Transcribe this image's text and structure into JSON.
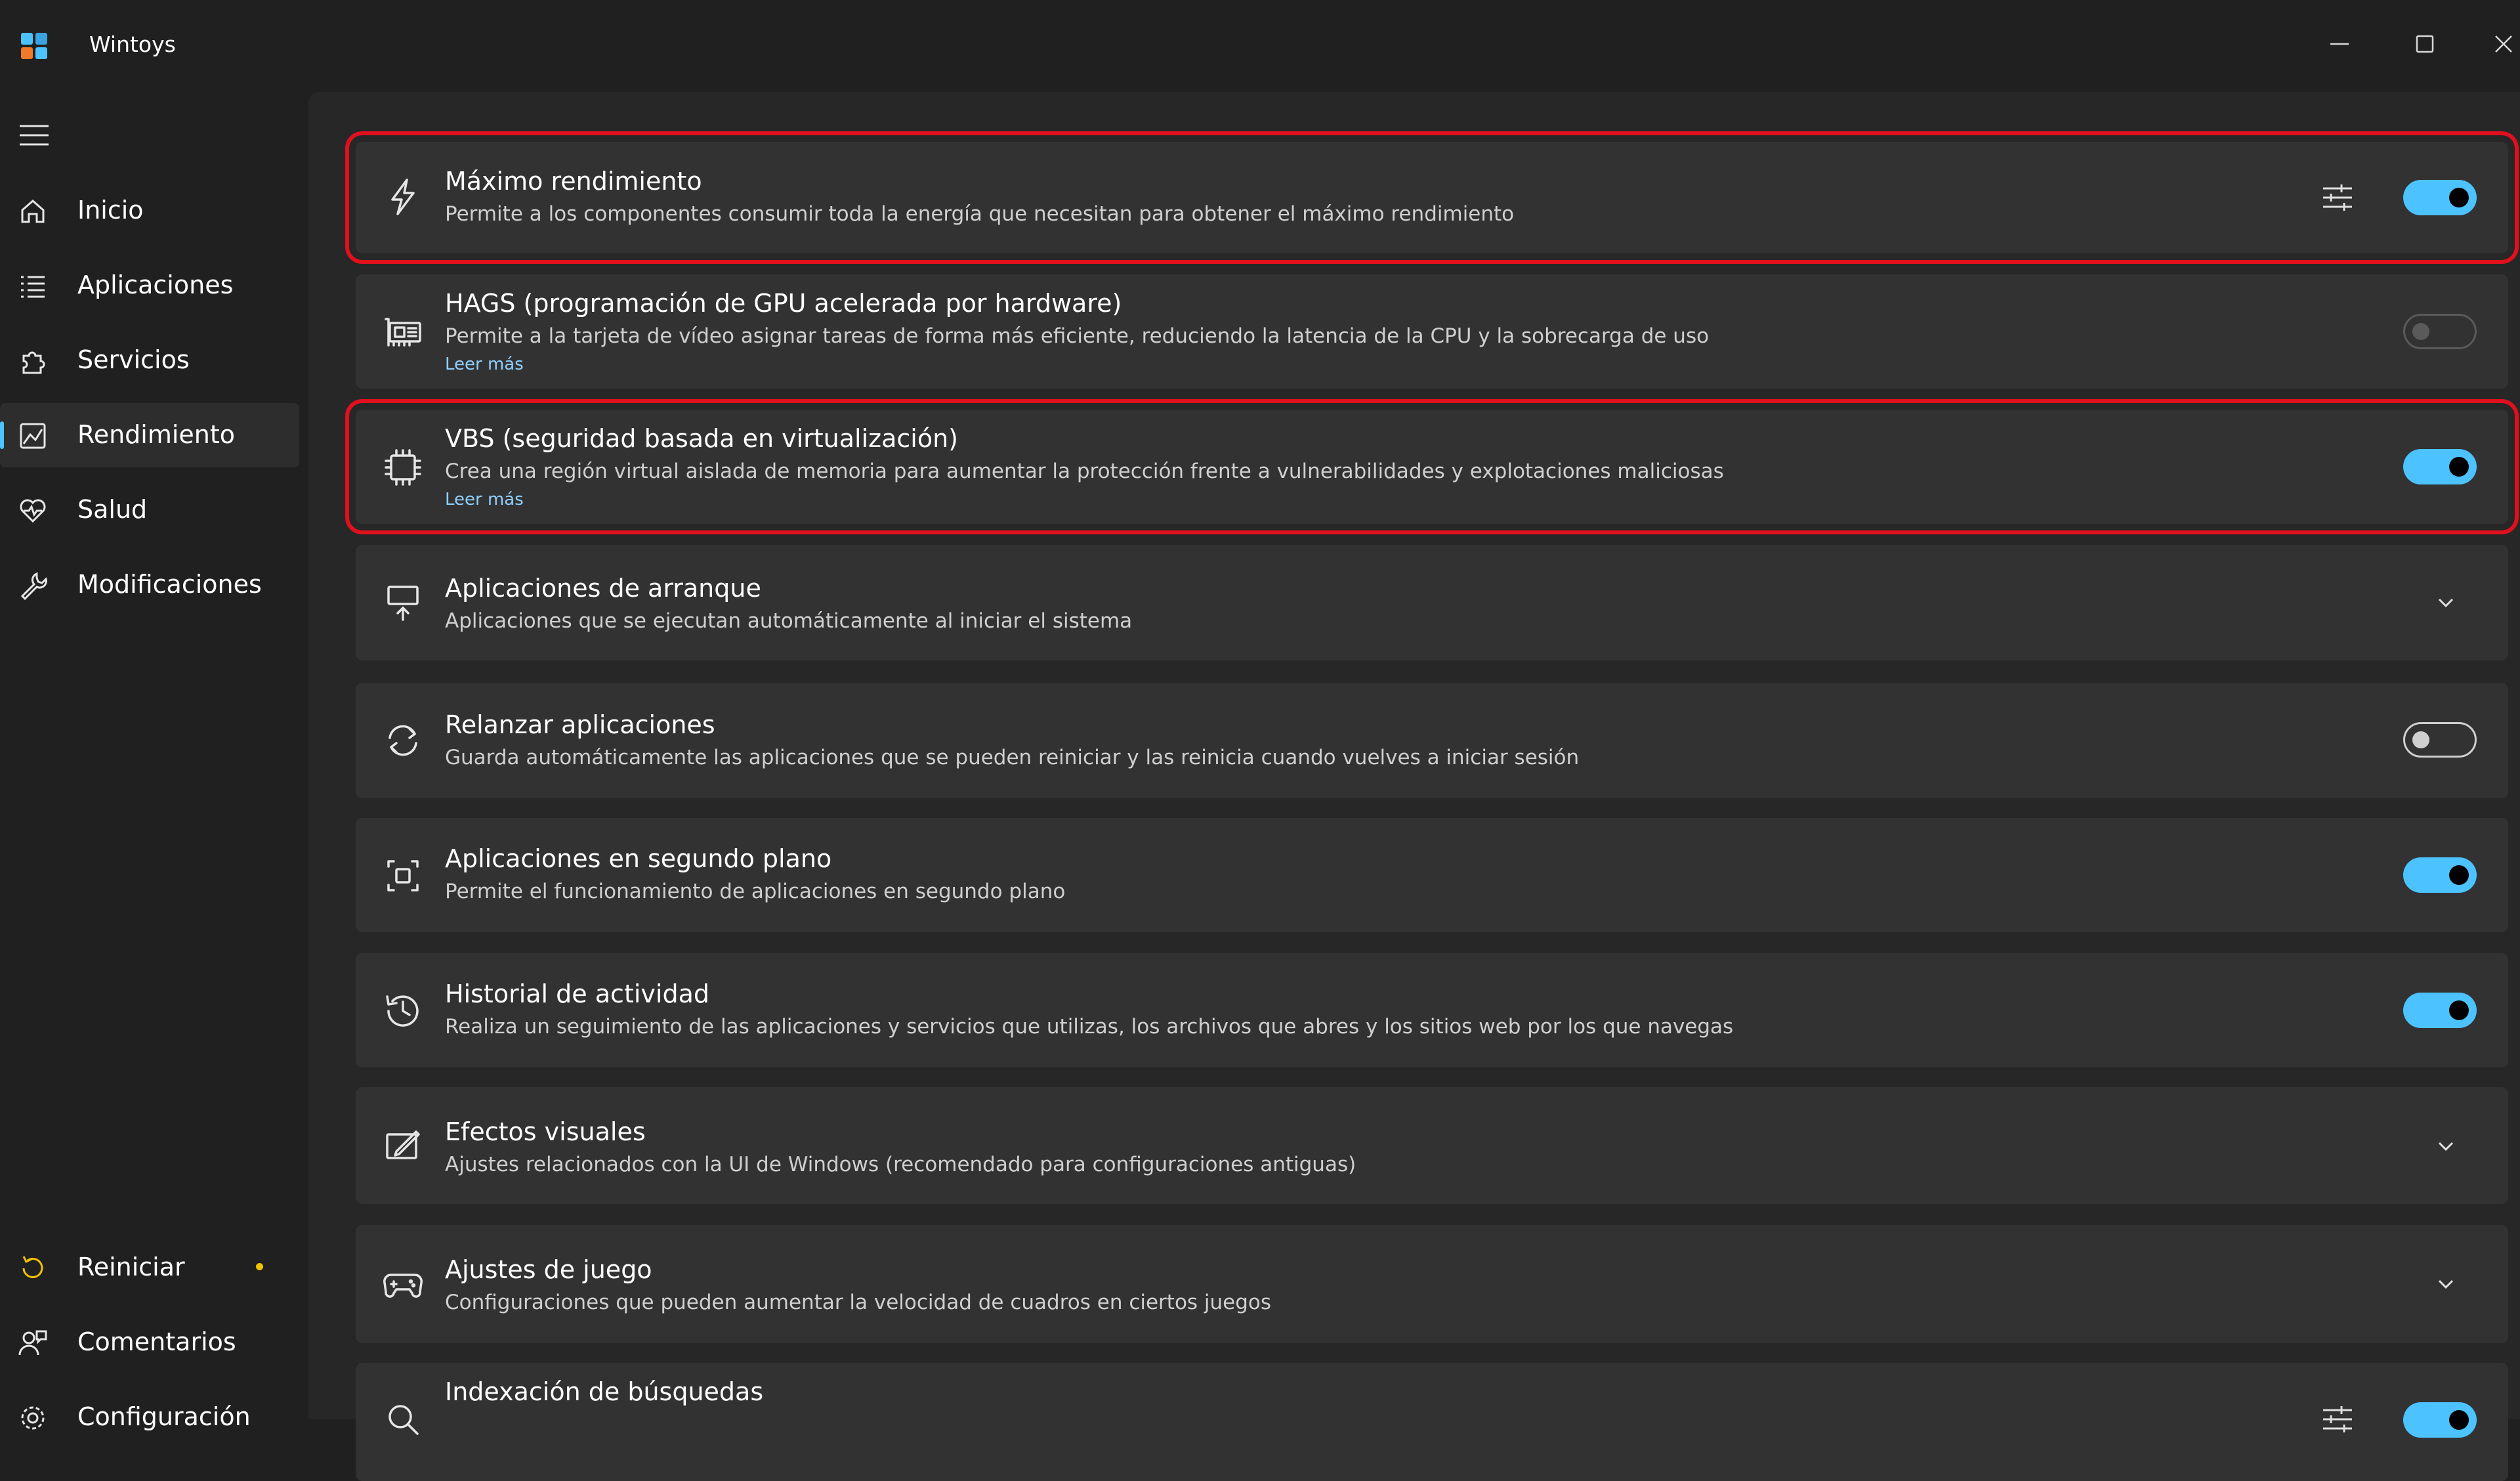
{
  "app": {
    "title": "Wintoys",
    "icon": "wintoys-logo"
  },
  "window_controls": [
    "minimize",
    "maximize",
    "close"
  ],
  "sidebar": {
    "menu_icon": "hamburger-icon",
    "items": [
      {
        "label": "Inicio",
        "icon": "home-icon"
      },
      {
        "label": "Aplicaciones",
        "icon": "apps-list-icon"
      },
      {
        "label": "Servicios",
        "icon": "puzzle-icon"
      },
      {
        "label": "Rendimiento",
        "icon": "performance-icon",
        "active": true
      },
      {
        "label": "Salud",
        "icon": "heart-icon"
      },
      {
        "label": "Modificaciones",
        "icon": "wrench-icon"
      }
    ],
    "bottom_items": [
      {
        "label": "Reiniciar",
        "icon": "restart-icon",
        "badge": true
      },
      {
        "label": "Comentarios",
        "icon": "feedback-icon"
      },
      {
        "label": "Configuración",
        "icon": "settings-icon"
      }
    ]
  },
  "cards": [
    {
      "title": "Máximo rendimiento",
      "desc": "Permite a los componentes consumir toda la energía que necesitan para obtener el máximo rendimiento",
      "icon": "lightning-icon",
      "control": "toggle-on",
      "has_settings": true,
      "highlighted": true
    },
    {
      "title": "HAGS (programación de GPU acelerada por hardware)",
      "desc": "Permite a la tarjeta de vídeo asignar tareas de forma más eficiente, reduciendo la latencia de la CPU y la sobrecarga de uso",
      "link": "Leer más",
      "icon": "gpu-icon",
      "control": "toggle-disabled"
    },
    {
      "title": "VBS (seguridad basada en virtualización)",
      "desc": "Crea una región virtual aislada de memoria para aumentar la protección frente a vulnerabilidades y explotaciones maliciosas",
      "link": "Leer más",
      "icon": "chip-icon",
      "control": "toggle-on",
      "highlighted": true
    },
    {
      "title": "Aplicaciones de arranque",
      "desc": "Aplicaciones que se ejecutan automáticamente al iniciar el sistema",
      "icon": "startup-icon",
      "control": "expand"
    },
    {
      "title": "Relanzar aplicaciones",
      "desc": "Guarda automáticamente las aplicaciones que se pueden reiniciar y las reinicia cuando vuelves a iniciar sesión",
      "icon": "relaunch-icon",
      "control": "toggle-off"
    },
    {
      "title": "Aplicaciones en segundo plano",
      "desc": "Permite el funcionamiento de aplicaciones en segundo plano",
      "icon": "background-apps-icon",
      "control": "toggle-on"
    },
    {
      "title": "Historial de actividad",
      "desc": "Realiza un seguimiento de las aplicaciones y servicios que utilizas, los archivos que abres y los sitios web por los que navegas",
      "icon": "history-icon",
      "control": "toggle-on"
    },
    {
      "title": "Efectos visuales",
      "desc": "Ajustes relacionados con la UI de Windows (recomendado para configuraciones antiguas)",
      "icon": "visual-effects-icon",
      "control": "expand"
    },
    {
      "title": "Ajustes de juego",
      "desc": "Configuraciones que pueden aumentar la velocidad de cuadros en ciertos juegos",
      "icon": "gamepad-icon",
      "control": "expand"
    },
    {
      "title": "Indexación de búsquedas",
      "icon": "search-icon",
      "control": "toggle-on",
      "has_settings": true
    }
  ],
  "colors": {
    "accent": "#4cc2ff",
    "highlight_border": "#e0101c",
    "badge": "#f2c300",
    "background": "#202020",
    "card": "#323232"
  }
}
